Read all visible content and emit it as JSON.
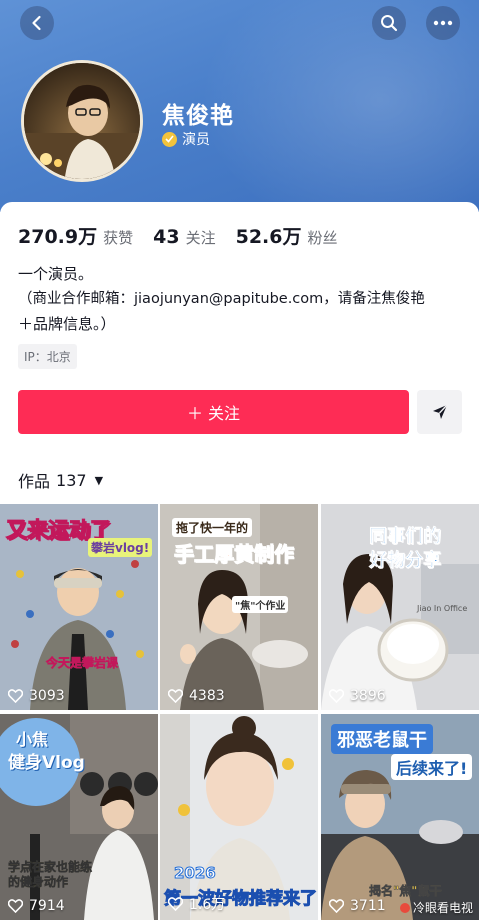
{
  "profile": {
    "name": "焦俊艳",
    "verify_label": "演员",
    "stats": [
      {
        "value": "270.9万",
        "label": "获赞"
      },
      {
        "value": "43",
        "label": "关注"
      },
      {
        "value": "52.6万",
        "label": "粉丝"
      }
    ],
    "bio_lines": [
      "一个演员。",
      "（商业合作邮箱：jiaojunyan@papitube.com，请备注焦俊艳",
      "＋品牌信息。）"
    ],
    "ip": "IP：北京"
  },
  "actions": {
    "follow_label": "＋ 关注"
  },
  "works": {
    "label": "作品",
    "count": "137",
    "tiles": [
      {
        "caption": "又来运动了",
        "caption2": "攀岩vlog!",
        "caption3": "今天是攀岩课",
        "likes": "3093"
      },
      {
        "caption": "拖了快一年的",
        "caption2": "手工厚黄制作",
        "caption3": "\"焦\"个作业",
        "likes": "4383"
      },
      {
        "caption": "同事们的",
        "caption2": "好物分享",
        "caption3": "Jiao In Office",
        "likes": "3896"
      },
      {
        "caption": "小焦",
        "caption2": "健身Vlog",
        "caption3": "学点在家也能练的健身动作",
        "likes": "7914"
      },
      {
        "caption": "2026",
        "caption2": "第一波好物推荐来了",
        "caption3": "",
        "likes": "1.6万"
      },
      {
        "caption": "邪恶老鼠干",
        "caption2": "后续来了!",
        "caption3": "揭名\"焦\"鼠干",
        "likes": "3711"
      }
    ]
  },
  "watermark": "冷眼看电视",
  "colors": {
    "accent": "#fe2c55",
    "header": "#4a7fca"
  }
}
